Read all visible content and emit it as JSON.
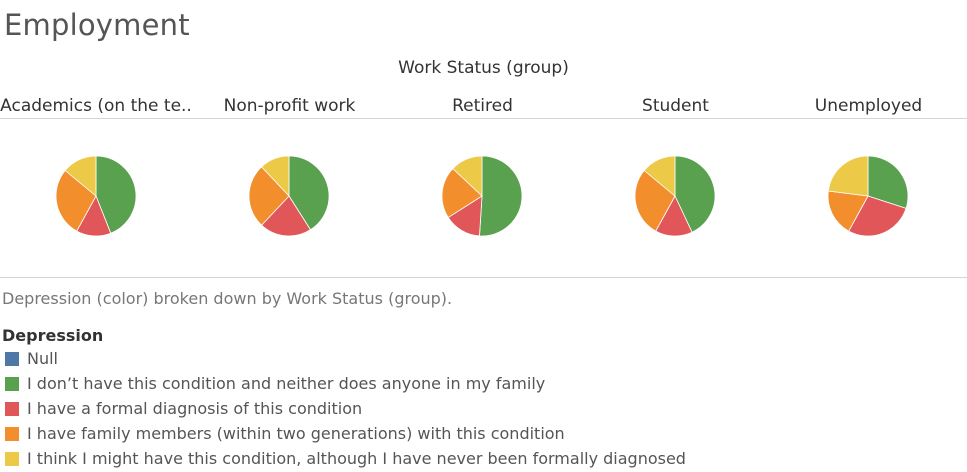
{
  "title": "Employment",
  "group_header": "Work Status (group)",
  "caption": "Depression (color) broken down by Work Status (group).",
  "legend": {
    "title": "Depression",
    "items": [
      {
        "label": "Null",
        "color": "#4e79a7"
      },
      {
        "label": "I don’t have this condition and neither does anyone in my family",
        "color": "#59a14f"
      },
      {
        "label": "I have a formal diagnosis of this condition",
        "color": "#e15759"
      },
      {
        "label": "I have family members (within two generations) with this condition",
        "color": "#f28e2b"
      },
      {
        "label": "I think I might have this condition, although I have never been formally diagnosed",
        "color": "#edc948"
      }
    ]
  },
  "chart_data": {
    "type": "pie",
    "categories": [
      "Academics (on the te..",
      "Non-profit work",
      "Retired",
      "Student",
      "Unemployed"
    ],
    "series_labels": [
      "Null",
      "I don’t have this condition and neither does anyone in my family",
      "I have a formal diagnosis of this condition",
      "I have family members (within two generations) with this condition",
      "I think I might have this condition, although I have never been formally diagnosed"
    ],
    "colors": [
      "#4e79a7",
      "#59a14f",
      "#e15759",
      "#f28e2b",
      "#edc948"
    ],
    "values": [
      [
        0,
        44,
        14,
        28,
        14
      ],
      [
        0,
        41,
        21,
        26,
        12
      ],
      [
        0,
        51,
        15,
        21,
        13
      ],
      [
        0,
        43,
        15,
        28,
        14
      ],
      [
        0,
        30,
        28,
        19,
        23
      ]
    ]
  }
}
